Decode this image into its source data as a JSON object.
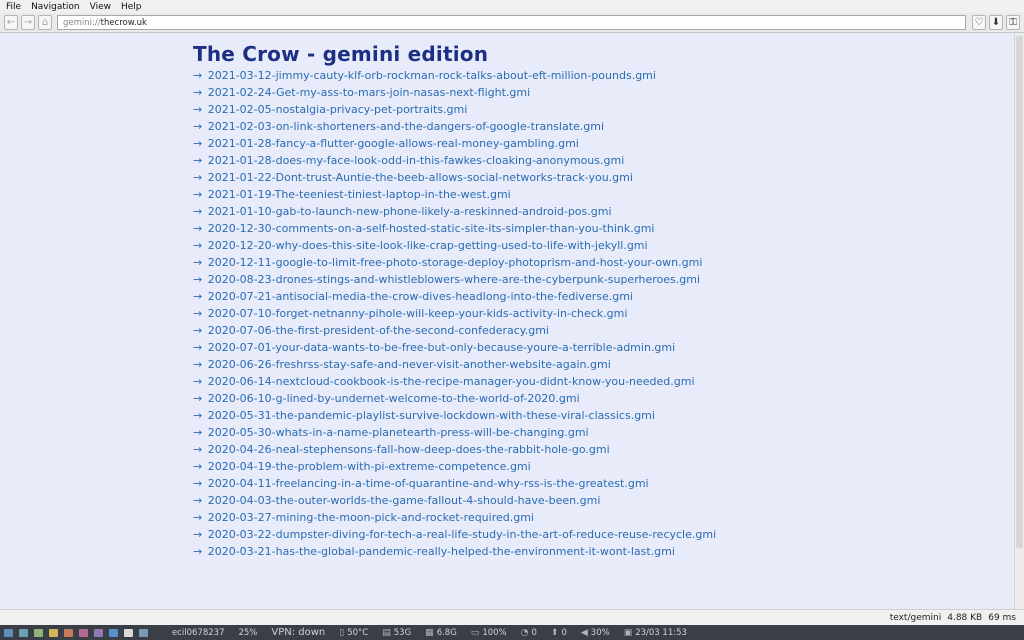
{
  "menu": [
    "File",
    "Navigation",
    "View",
    "Help"
  ],
  "toolbar": {
    "back_icon": "←",
    "forward_icon": "→",
    "home_icon": "⌂",
    "url_scheme": "gemini://",
    "url_host": "thecrow.uk",
    "bookmark_icon": "♡",
    "download_icon": "⬇",
    "identity_icon": "⚿"
  },
  "page": {
    "title": "The Crow - gemini edition",
    "arrow": "→",
    "links": [
      "2021-03-12-jimmy-cauty-klf-orb-rockman-rock-talks-about-eft-million-pounds.gmi",
      "2021-02-24-Get-my-ass-to-mars-join-nasas-next-flight.gmi",
      "2021-02-05-nostalgia-privacy-pet-portraits.gmi",
      "2021-02-03-on-link-shorteners-and-the-dangers-of-google-translate.gmi",
      "2021-01-28-fancy-a-flutter-google-allows-real-money-gambling.gmi",
      "2021-01-28-does-my-face-look-odd-in-this-fawkes-cloaking-anonymous.gmi",
      "2021-01-22-Dont-trust-Auntie-the-beeb-allows-social-networks-track-you.gmi",
      "2021-01-19-The-teeniest-tiniest-laptop-in-the-west.gmi",
      "2021-01-10-gab-to-launch-new-phone-likely-a-reskinned-android-pos.gmi",
      "2020-12-30-comments-on-a-self-hosted-static-site-its-simpler-than-you-think.gmi",
      "2020-12-20-why-does-this-site-look-like-crap-getting-used-to-life-with-jekyll.gmi",
      "2020-12-11-google-to-limit-free-photo-storage-deploy-photoprism-and-host-your-own.gmi",
      "2020-08-23-drones-stings-and-whistleblowers-where-are-the-cyberpunk-superheroes.gmi",
      "2020-07-21-antisocial-media-the-crow-dives-headlong-into-the-fediverse.gmi",
      "2020-07-10-forget-netnanny-pihole-will-keep-your-kids-activity-in-check.gmi",
      "2020-07-06-the-first-president-of-the-second-confederacy.gmi",
      "2020-07-01-your-data-wants-to-be-free-but-only-because-youre-a-terrible-admin.gmi",
      "2020-06-26-freshrss-stay-safe-and-never-visit-another-website-again.gmi",
      "2020-06-14-nextcloud-cookbook-is-the-recipe-manager-you-didnt-know-you-needed.gmi",
      "2020-06-10-g-lined-by-undernet-welcome-to-the-world-of-2020.gmi",
      "2020-05-31-the-pandemic-playlist-survive-lockdown-with-these-viral-classics.gmi",
      "2020-05-30-whats-in-a-name-planetearth-press-will-be-changing.gmi",
      "2020-04-26-neal-stephensons-fall-how-deep-does-the-rabbit-hole-go.gmi",
      "2020-04-19-the-problem-with-pi-extreme-competence.gmi",
      "2020-04-11-freelancing-in-a-time-of-quarantine-and-why-rss-is-the-greatest.gmi",
      "2020-04-03-the-outer-worlds-the-game-fallout-4-should-have-been.gmi",
      "2020-03-27-mining-the-moon-pick-and-rocket-required.gmi",
      "2020-03-22-dumpster-diving-for-tech-a-real-life-study-in-the-art-of-reduce-reuse-recycle.gmi",
      "2020-03-21-has-the-global-pandemic-really-helped-the-environment-it-wont-last.gmi"
    ]
  },
  "status": {
    "mime": "text/gemini",
    "size": "4.88 KB",
    "time": "69 ms"
  },
  "taskbar": {
    "workspace_colors": [
      "#5e8fb8",
      "#6aa3b0",
      "#8fb37a",
      "#d4b35a",
      "#c97a5a",
      "#b56a8f",
      "#8f7ab5",
      "#5a8fc9",
      "#d9d9d9",
      "#7a9ab5"
    ],
    "window_title": "ecil0678237",
    "cpu": "25%",
    "vpn": "VPN: down",
    "temp": "50°C",
    "disk": "53G",
    "mem": "6.8G",
    "battery": "100%",
    "notif": "0",
    "updates": "0",
    "volume": "30%",
    "datetime": "23/03 11:53"
  }
}
